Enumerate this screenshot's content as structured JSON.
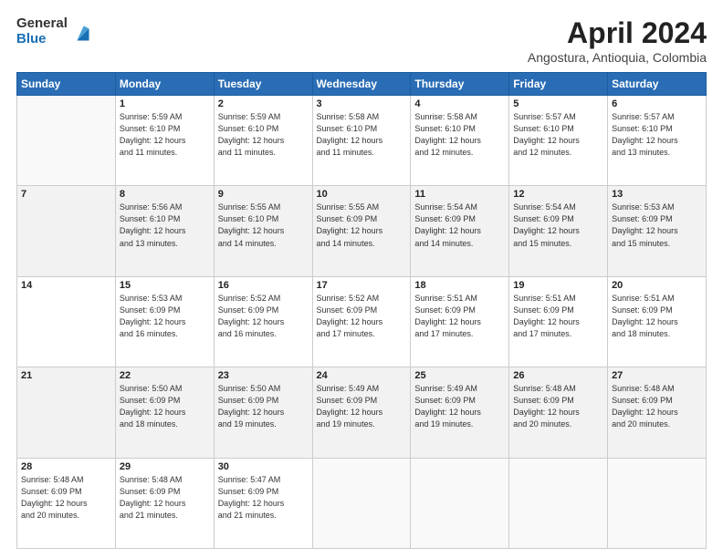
{
  "logo": {
    "general": "General",
    "blue": "Blue"
  },
  "header": {
    "title": "April 2024",
    "location": "Angostura, Antioquia, Colombia"
  },
  "weekdays": [
    "Sunday",
    "Monday",
    "Tuesday",
    "Wednesday",
    "Thursday",
    "Friday",
    "Saturday"
  ],
  "weeks": [
    [
      {
        "day": "",
        "info": ""
      },
      {
        "day": "1",
        "info": "Sunrise: 5:59 AM\nSunset: 6:10 PM\nDaylight: 12 hours\nand 11 minutes."
      },
      {
        "day": "2",
        "info": "Sunrise: 5:59 AM\nSunset: 6:10 PM\nDaylight: 12 hours\nand 11 minutes."
      },
      {
        "day": "3",
        "info": "Sunrise: 5:58 AM\nSunset: 6:10 PM\nDaylight: 12 hours\nand 11 minutes."
      },
      {
        "day": "4",
        "info": "Sunrise: 5:58 AM\nSunset: 6:10 PM\nDaylight: 12 hours\nand 12 minutes."
      },
      {
        "day": "5",
        "info": "Sunrise: 5:57 AM\nSunset: 6:10 PM\nDaylight: 12 hours\nand 12 minutes."
      },
      {
        "day": "6",
        "info": "Sunrise: 5:57 AM\nSunset: 6:10 PM\nDaylight: 12 hours\nand 13 minutes."
      }
    ],
    [
      {
        "day": "7",
        "info": ""
      },
      {
        "day": "8",
        "info": "Sunrise: 5:56 AM\nSunset: 6:10 PM\nDaylight: 12 hours\nand 13 minutes."
      },
      {
        "day": "9",
        "info": "Sunrise: 5:55 AM\nSunset: 6:10 PM\nDaylight: 12 hours\nand 14 minutes."
      },
      {
        "day": "10",
        "info": "Sunrise: 5:55 AM\nSunset: 6:09 PM\nDaylight: 12 hours\nand 14 minutes."
      },
      {
        "day": "11",
        "info": "Sunrise: 5:54 AM\nSunset: 6:09 PM\nDaylight: 12 hours\nand 14 minutes."
      },
      {
        "day": "12",
        "info": "Sunrise: 5:54 AM\nSunset: 6:09 PM\nDaylight: 12 hours\nand 15 minutes."
      },
      {
        "day": "13",
        "info": "Sunrise: 5:53 AM\nSunset: 6:09 PM\nDaylight: 12 hours\nand 15 minutes."
      }
    ],
    [
      {
        "day": "14",
        "info": ""
      },
      {
        "day": "15",
        "info": "Sunrise: 5:53 AM\nSunset: 6:09 PM\nDaylight: 12 hours\nand 16 minutes."
      },
      {
        "day": "16",
        "info": "Sunrise: 5:52 AM\nSunset: 6:09 PM\nDaylight: 12 hours\nand 16 minutes."
      },
      {
        "day": "17",
        "info": "Sunrise: 5:52 AM\nSunset: 6:09 PM\nDaylight: 12 hours\nand 17 minutes."
      },
      {
        "day": "18",
        "info": "Sunrise: 5:51 AM\nSunset: 6:09 PM\nDaylight: 12 hours\nand 17 minutes."
      },
      {
        "day": "19",
        "info": "Sunrise: 5:51 AM\nSunset: 6:09 PM\nDaylight: 12 hours\nand 17 minutes."
      },
      {
        "day": "20",
        "info": "Sunrise: 5:51 AM\nSunset: 6:09 PM\nDaylight: 12 hours\nand 18 minutes."
      }
    ],
    [
      {
        "day": "21",
        "info": ""
      },
      {
        "day": "22",
        "info": "Sunrise: 5:50 AM\nSunset: 6:09 PM\nDaylight: 12 hours\nand 18 minutes."
      },
      {
        "day": "23",
        "info": "Sunrise: 5:50 AM\nSunset: 6:09 PM\nDaylight: 12 hours\nand 19 minutes."
      },
      {
        "day": "24",
        "info": "Sunrise: 5:49 AM\nSunset: 6:09 PM\nDaylight: 12 hours\nand 19 minutes."
      },
      {
        "day": "25",
        "info": "Sunrise: 5:49 AM\nSunset: 6:09 PM\nDaylight: 12 hours\nand 19 minutes."
      },
      {
        "day": "26",
        "info": "Sunrise: 5:48 AM\nSunset: 6:09 PM\nDaylight: 12 hours\nand 20 minutes."
      },
      {
        "day": "27",
        "info": "Sunrise: 5:48 AM\nSunset: 6:09 PM\nDaylight: 12 hours\nand 20 minutes."
      }
    ],
    [
      {
        "day": "28",
        "info": "Sunrise: 5:48 AM\nSunset: 6:09 PM\nDaylight: 12 hours\nand 20 minutes."
      },
      {
        "day": "29",
        "info": "Sunrise: 5:48 AM\nSunset: 6:09 PM\nDaylight: 12 hours\nand 21 minutes."
      },
      {
        "day": "30",
        "info": "Sunrise: 5:47 AM\nSunset: 6:09 PM\nDaylight: 12 hours\nand 21 minutes."
      },
      {
        "day": "",
        "info": ""
      },
      {
        "day": "",
        "info": ""
      },
      {
        "day": "",
        "info": ""
      },
      {
        "day": "",
        "info": ""
      }
    ]
  ]
}
